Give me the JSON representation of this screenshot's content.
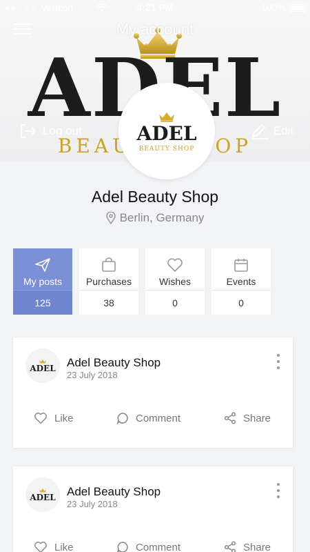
{
  "status_bar": {
    "carrier": "Verizon",
    "time": "4:21 PM",
    "battery": "100%"
  },
  "header": {
    "title": "My account",
    "logout_label": "Log out",
    "edit_label": "Edit"
  },
  "brand": {
    "word": "ADEL",
    "subtitle_hero": "BEAUTY SHOP",
    "subtitle": "BEAUTY SHOP",
    "gold": "#c9a227"
  },
  "profile": {
    "name": "Adel Beauty Shop",
    "location": "Berlin, Germany"
  },
  "stats": [
    {
      "label": "My posts",
      "count": "125",
      "icon": "send-icon",
      "active": true
    },
    {
      "label": "Purchases",
      "count": "38",
      "icon": "bag-icon",
      "active": false
    },
    {
      "label": "Wishes",
      "count": "0",
      "icon": "heart-icon",
      "active": false
    },
    {
      "label": "Events",
      "count": "0",
      "icon": "calendar-icon",
      "active": false
    }
  ],
  "posts": [
    {
      "author": "Adel Beauty Shop",
      "date": "23 July 2018",
      "like": "Like",
      "comment": "Comment",
      "share": "Share"
    },
    {
      "author": "Adel Beauty Shop",
      "date": "23 July 2018",
      "like": "Like",
      "comment": "Comment",
      "share": "Share"
    }
  ],
  "colors": {
    "accent": "#7a8fd6",
    "background": "#f2f3f6"
  }
}
